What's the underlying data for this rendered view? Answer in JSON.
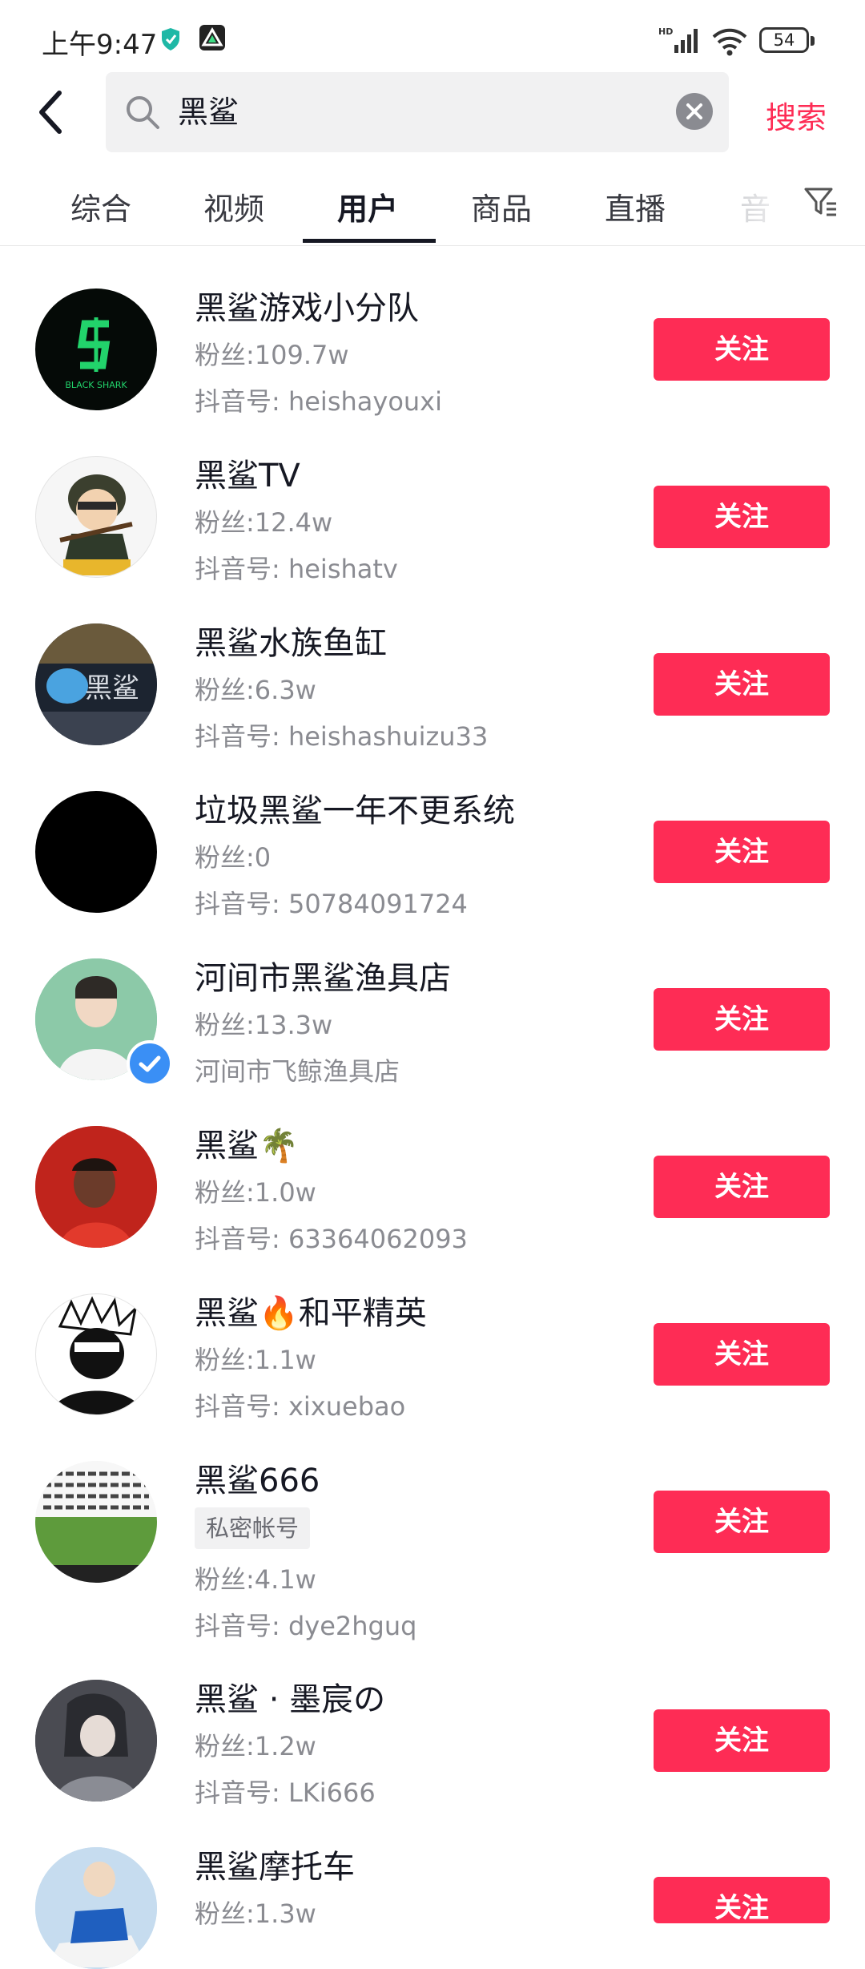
{
  "status_bar": {
    "time": "上午9:47",
    "battery": "54"
  },
  "search": {
    "query": "黑鲨",
    "submit_label": "搜索"
  },
  "tabs": [
    {
      "label": "综合"
    },
    {
      "label": "视频"
    },
    {
      "label": "用户"
    },
    {
      "label": "商品"
    },
    {
      "label": "直播"
    },
    {
      "label": "音"
    }
  ],
  "users": [
    {
      "name": "黑鲨游戏小分队",
      "fans": "粉丝:109.7w",
      "id": "抖音号: heishayouxi",
      "follow": "关注"
    },
    {
      "name": "黑鲨TV",
      "fans": "粉丝:12.4w",
      "id": "抖音号: heishatv",
      "follow": "关注"
    },
    {
      "name": "黑鲨水族鱼缸",
      "fans": "粉丝:6.3w",
      "id": "抖音号: heishashuizu33",
      "follow": "关注"
    },
    {
      "name": "垃圾黑鲨一年不更系统",
      "fans": "粉丝:0",
      "id": "抖音号: 50784091724",
      "follow": "关注"
    },
    {
      "name": "河间市黑鲨渔具店",
      "fans": "粉丝:13.3w",
      "id": "河间市飞鲸渔具店",
      "follow": "关注"
    },
    {
      "name": "黑鲨🌴",
      "fans": "粉丝:1.0w",
      "id": "抖音号: 63364062093",
      "follow": "关注"
    },
    {
      "name": "黑鲨🔥和平精英",
      "fans": "粉丝:1.1w",
      "id": "抖音号: xixuebao",
      "follow": "关注"
    },
    {
      "name": "黑鲨666",
      "tag": "私密帐号",
      "fans": "粉丝:4.1w",
      "id": "抖音号: dye2hguq",
      "follow": "关注"
    },
    {
      "name": "黑鲨 · 墨宸の",
      "fans": "粉丝:1.2w",
      "id": "抖音号: LKi666",
      "follow": "关注"
    },
    {
      "name": "黑鲨摩托车",
      "fans": "粉丝:1.3w",
      "follow": "关注"
    }
  ],
  "colors": {
    "accent": "#fe2c55",
    "secondary_text": "#8a8b91"
  }
}
